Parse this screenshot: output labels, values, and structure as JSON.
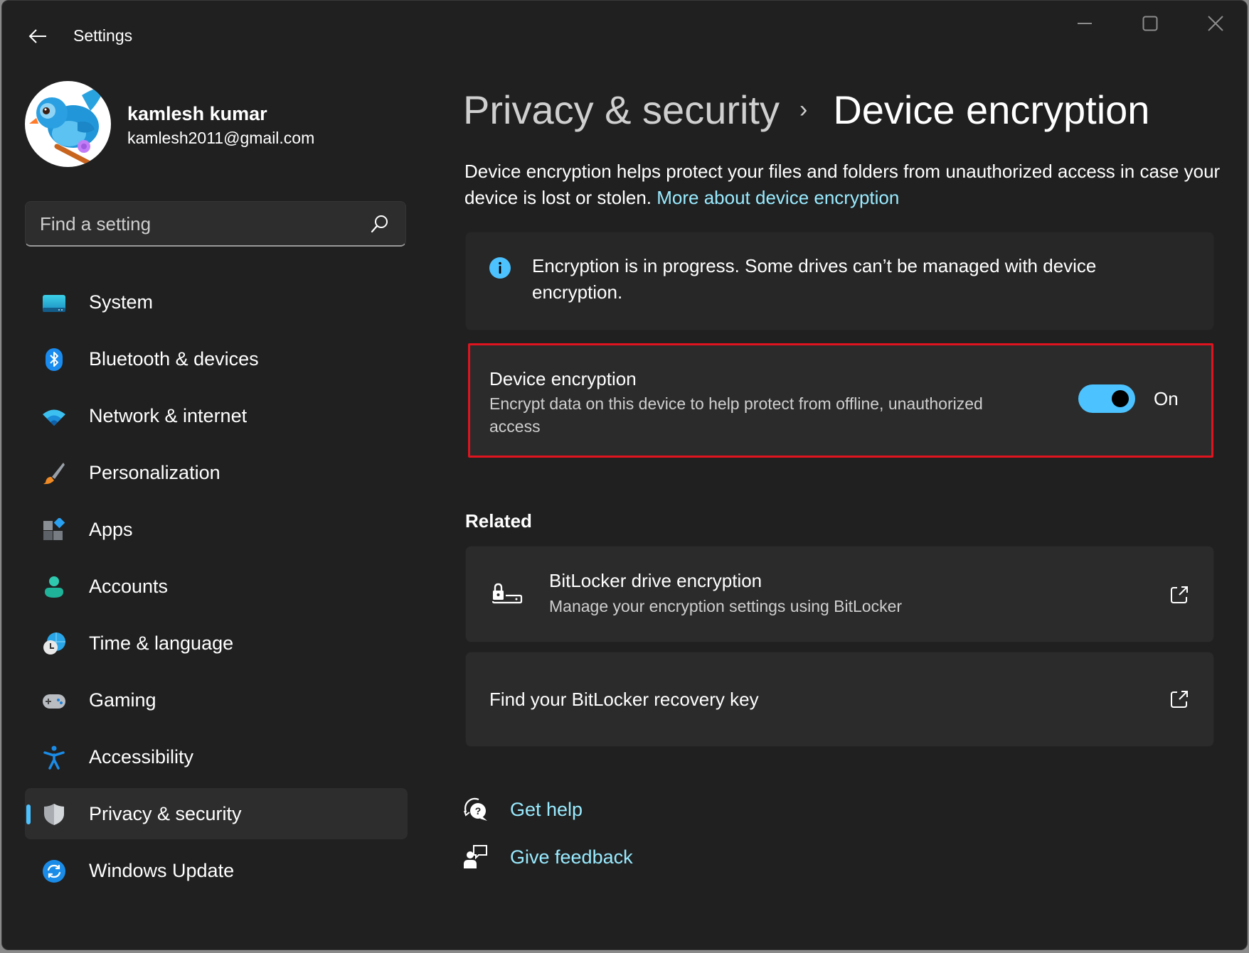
{
  "window": {
    "title": "Settings",
    "controls": {
      "minimize": "minimize-icon",
      "maximize": "maximize-icon",
      "close": "close-icon"
    }
  },
  "profile": {
    "name": "kamlesh kumar",
    "email": "kamlesh2011@gmail.com"
  },
  "search": {
    "placeholder": "Find a setting",
    "value": ""
  },
  "sidebar": {
    "selected_index": 9,
    "accent_color": "#4cc2ff",
    "items": [
      {
        "label": "System",
        "icon": "system-icon"
      },
      {
        "label": "Bluetooth & devices",
        "icon": "bluetooth-icon"
      },
      {
        "label": "Network & internet",
        "icon": "wifi-icon"
      },
      {
        "label": "Personalization",
        "icon": "paintbrush-icon"
      },
      {
        "label": "Apps",
        "icon": "apps-icon"
      },
      {
        "label": "Accounts",
        "icon": "account-icon"
      },
      {
        "label": "Time & language",
        "icon": "time-language-icon"
      },
      {
        "label": "Gaming",
        "icon": "gamepad-icon"
      },
      {
        "label": "Accessibility",
        "icon": "accessibility-icon"
      },
      {
        "label": "Privacy & security",
        "icon": "shield-icon"
      },
      {
        "label": "Windows Update",
        "icon": "windows-update-icon"
      }
    ]
  },
  "main": {
    "breadcrumb": {
      "parent": "Privacy & security",
      "separator": "›",
      "current": "Device encryption"
    },
    "description": {
      "text": "Device encryption helps protect your files and folders from unauthorized access in case your device is lost or stolen.",
      "link": "More about device encryption"
    },
    "info_banner": {
      "icon": "info-icon",
      "text": "Encryption is in progress. Some drives can’t be managed with device encryption."
    },
    "device_encryption": {
      "title": "Device encryption",
      "subtitle": "Encrypt data on this device to help protect from offline, unauthorized access",
      "toggle_on": true,
      "toggle_label": "On",
      "highlight_color": "#e0141e"
    },
    "related": {
      "heading": "Related",
      "items": [
        {
          "title": "BitLocker drive encryption",
          "subtitle": "Manage your encryption settings using BitLocker",
          "icon": "bitlocker-icon",
          "trailing_icon": "external-link-icon"
        },
        {
          "title": "Find your BitLocker recovery key",
          "trailing_icon": "external-link-icon"
        }
      ]
    },
    "help": {
      "get_help": "Get help",
      "give_feedback": "Give feedback"
    }
  }
}
